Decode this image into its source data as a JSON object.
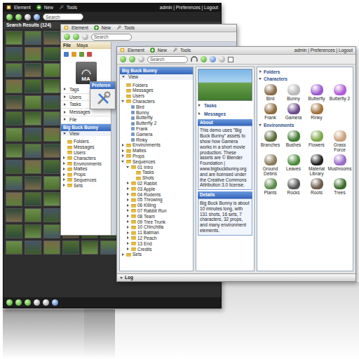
{
  "back_window": {
    "menu": [
      "Element",
      "New",
      "Tools"
    ],
    "user_links": "admin | Preferences | Logout",
    "search": {
      "placeholder": "Search"
    },
    "results_title": "Search Results (124)"
  },
  "middle_window": {
    "menu": [
      "Element",
      "New",
      "Tools"
    ],
    "search": {
      "placeholder": "Search"
    },
    "file_panel": {
      "title": "File",
      "app": "Maya",
      "file_badge": "MA"
    },
    "sections": [
      "Tags",
      "Users",
      "Tasks",
      "Messages",
      "File"
    ],
    "project": {
      "title": "Big Buck Bunny",
      "view": "View",
      "tree": [
        {
          "label": "Folders",
          "kind": "folder"
        },
        {
          "label": "Messages",
          "kind": "folder"
        },
        {
          "label": "Users",
          "kind": "folder"
        },
        {
          "label": "Characters",
          "kind": "folder",
          "expanded": false
        },
        {
          "label": "Environments",
          "kind": "folder",
          "expanded": false
        },
        {
          "label": "Mattes",
          "kind": "folder",
          "expanded": false
        },
        {
          "label": "Props",
          "kind": "folder",
          "expanded": false
        },
        {
          "label": "Sequences",
          "kind": "folder",
          "expanded": false
        },
        {
          "label": "Sets",
          "kind": "folder",
          "expanded": false
        }
      ]
    }
  },
  "preferences_dialog": {
    "title": "Preferen"
  },
  "front_window": {
    "menu": [
      "Element",
      "New",
      "Tools"
    ],
    "user_links": "admin | Preferences | Logout",
    "search": {
      "placeholder": "Search"
    },
    "project": {
      "title": "Big Buck Bunny",
      "view": "View",
      "tree": [
        {
          "label": "Folders",
          "kind": "folder"
        },
        {
          "label": "Messages",
          "kind": "folder"
        },
        {
          "label": "Users",
          "kind": "folder"
        },
        {
          "label": "Characters",
          "kind": "folder",
          "expanded": true,
          "children": [
            {
              "label": "Bird",
              "kind": "asset"
            },
            {
              "label": "Bunny",
              "kind": "asset"
            },
            {
              "label": "Butterfly",
              "kind": "asset"
            },
            {
              "label": "Butterfly 2",
              "kind": "asset"
            },
            {
              "label": "Frank",
              "kind": "asset"
            },
            {
              "label": "Gamera",
              "kind": "asset"
            },
            {
              "label": "Rinky",
              "kind": "asset"
            }
          ]
        },
        {
          "label": "Environments",
          "kind": "folder",
          "expanded": false
        },
        {
          "label": "Mattes",
          "kind": "folder",
          "expanded": false
        },
        {
          "label": "Props",
          "kind": "folder",
          "expanded": false
        },
        {
          "label": "Sequences",
          "kind": "folder",
          "expanded": true,
          "children": [
            {
              "label": "01 Intro",
              "kind": "folder",
              "expanded": true,
              "children": [
                {
                  "label": "Tasks",
                  "kind": "folder"
                },
                {
                  "label": "Shots",
                  "kind": "folder"
                }
              ]
            },
            {
              "label": "02 Rabbit",
              "kind": "folder",
              "expanded": false
            },
            {
              "label": "03 Apple",
              "kind": "folder",
              "expanded": false
            },
            {
              "label": "04 Rodents",
              "kind": "folder",
              "expanded": false
            },
            {
              "label": "05 Throwing",
              "kind": "folder",
              "expanded": false
            },
            {
              "label": "06 Killing",
              "kind": "folder",
              "expanded": false
            },
            {
              "label": "07 Rabbit Run",
              "kind": "folder",
              "expanded": false
            },
            {
              "label": "08 Team",
              "kind": "folder",
              "expanded": false
            },
            {
              "label": "09 Tree Trunk",
              "kind": "folder",
              "expanded": false
            },
            {
              "label": "10 Chinchilla",
              "kind": "folder",
              "expanded": false
            },
            {
              "label": "11 Batman",
              "kind": "folder",
              "expanded": false
            },
            {
              "label": "12 Peach",
              "kind": "folder",
              "expanded": false
            },
            {
              "label": "13 End",
              "kind": "folder",
              "expanded": false
            },
            {
              "label": "Credits",
              "kind": "folder",
              "expanded": false
            }
          ]
        },
        {
          "label": "Sets",
          "kind": "folder",
          "expanded": false
        }
      ]
    },
    "info": {
      "sections": [
        {
          "title": "Tasks",
          "expanded": false
        },
        {
          "title": "Messages",
          "expanded": false
        }
      ],
      "about": {
        "title": "About",
        "text": "This demo uses \"Big Buck Bunny\" assets to show how Gamera works in a short movie production. These assets are © Blender Foundation | www.bigbuckbunny.org and are licensed under the Creative Commons Attribution 3.0 license."
      },
      "details": {
        "title": "Details",
        "text": "Big Buck Bunny is about 10 minutes long, with 131 shots, 16 sets, 7 characters, 32 props, and many environment elements."
      }
    },
    "browser": {
      "groups": [
        {
          "title": "Folders",
          "expanded": false,
          "items": []
        },
        {
          "title": "Characters",
          "expanded": true,
          "items": [
            {
              "label": "Bird",
              "color": "#8a6b4a"
            },
            {
              "label": "Bunny",
              "color": "#b9b9b9"
            },
            {
              "label": "Butterfly",
              "color": "#9b59d0"
            },
            {
              "label": "Butterfly 2",
              "color": "#b05ad8"
            },
            {
              "label": "Frank",
              "color": "#8e6a3c"
            },
            {
              "label": "Gamera",
              "color": "#6b4a8a"
            },
            {
              "label": "Rinky",
              "color": "#a0703a"
            }
          ]
        },
        {
          "title": "Environments",
          "expanded": true,
          "items": [
            {
              "label": "Branches",
              "color": "#5a6b3a"
            },
            {
              "label": "Bushes",
              "color": "#3f7a32"
            },
            {
              "label": "Flowers",
              "color": "#7aa84a"
            },
            {
              "label": "Grass Force",
              "color": "#c9a07a"
            },
            {
              "label": "Ground Debris",
              "color": "#8a7a5a"
            },
            {
              "label": "Leaves",
              "color": "#4a8a3a"
            },
            {
              "label": "Material Library",
              "color": "#222222"
            },
            {
              "label": "Mushrooms",
              "color": "#9a6ac8"
            },
            {
              "label": "Plants",
              "color": "#5a8a4a"
            },
            {
              "label": "Rocks",
              "color": "#555555"
            },
            {
              "label": "Roots",
              "color": "#6a5a4a"
            },
            {
              "label": "Trees",
              "color": "#3a6a2a"
            }
          ]
        }
      ]
    },
    "log": {
      "title": "Log",
      "expanded": true
    }
  }
}
